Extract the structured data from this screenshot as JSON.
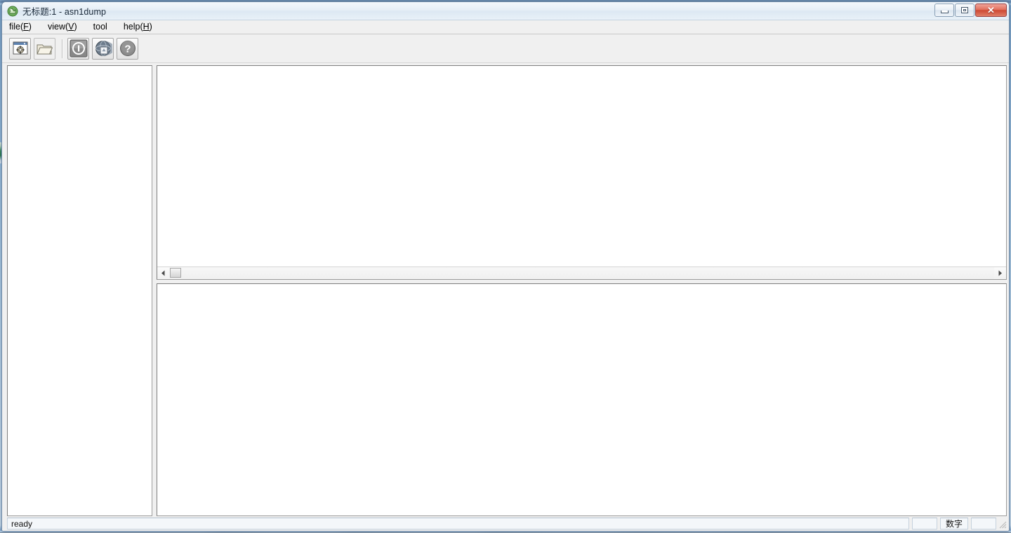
{
  "window": {
    "title": "无标题:1 - asn1dump",
    "app_icon": "asn1dump-app-icon",
    "caption_buttons": [
      {
        "name": "minimize",
        "glyph": "minimize-icon",
        "label": ""
      },
      {
        "name": "maximize",
        "glyph": "maximize-icon",
        "label": ""
      },
      {
        "name": "close",
        "glyph": "close-icon",
        "label": "✕"
      }
    ]
  },
  "menu": {
    "items": [
      {
        "text": "file",
        "accel": "F"
      },
      {
        "text": "view",
        "accel": "V"
      },
      {
        "text": "tool",
        "accel": ""
      },
      {
        "text": "help",
        "accel": "H"
      }
    ]
  },
  "toolbar": {
    "buttons": [
      {
        "name": "new-document-button",
        "icon": "window-gear-icon",
        "tooltip": ""
      },
      {
        "name": "open-file-button",
        "icon": "folder-open-icon",
        "tooltip": ""
      },
      {
        "name": "info-button",
        "icon": "info-circle-icon",
        "tooltip": ""
      },
      {
        "name": "web-export-button",
        "icon": "globe-icon",
        "tooltip": ""
      },
      {
        "name": "help-button",
        "icon": "question-circle-icon",
        "tooltip": ""
      }
    ]
  },
  "panes": {
    "tree": {
      "name": "asn1-tree-pane",
      "content": ""
    },
    "hex": {
      "name": "hex-dump-pane",
      "content": ""
    },
    "detail": {
      "name": "detail-output-pane",
      "content": ""
    }
  },
  "scrollbar": {
    "left_arrow": "◀",
    "right_arrow": "▶",
    "thumb_position": 0
  },
  "status_bar": {
    "message": "ready",
    "cells": [
      {
        "name": "status-cell-caps",
        "text": ""
      },
      {
        "name": "status-cell-num",
        "text": "数字"
      },
      {
        "name": "status-cell-scroll",
        "text": ""
      }
    ]
  },
  "colors": {
    "window_border": "#6f8aa8",
    "face": "#f0f0f0",
    "pane_bg": "#ffffff",
    "close_button": "#cd4a34",
    "desktop": "#9dc2e3"
  }
}
